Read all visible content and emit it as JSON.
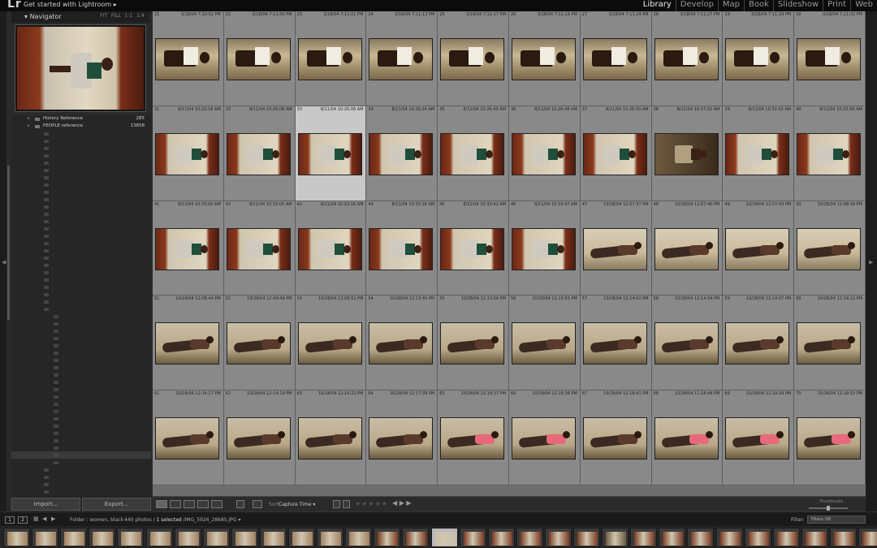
{
  "topbar": {
    "logo": "Lr",
    "get_started": "Get started with Lightroom  ▸",
    "modules": [
      {
        "label": "Library",
        "active": true
      },
      {
        "label": "Develop",
        "active": false
      },
      {
        "label": "Map",
        "active": false
      },
      {
        "label": "Book",
        "active": false
      },
      {
        "label": "Slideshow",
        "active": false
      },
      {
        "label": "Print",
        "active": false
      },
      {
        "label": "Web",
        "active": false
      }
    ]
  },
  "navigator": {
    "title": "Navigator",
    "options": "FIT FILL 1:1 1:4"
  },
  "folders": {
    "rows": [
      {
        "name": "History Reference",
        "count": "285",
        "level": 1,
        "style": "main"
      },
      {
        "name": "PEOPLE reference",
        "count": "13858",
        "level": 1,
        "style": "main"
      }
    ]
  },
  "left_bottom": {
    "import_label": "Import...",
    "export_label": "Export..."
  },
  "grid": {
    "rows": [
      [
        {
          "num": "21",
          "date": "3/18/04 7:10:52 PM"
        },
        {
          "num": "22",
          "date": "3/18/04 7:11:00 PM"
        },
        {
          "num": "23",
          "date": "3/18/04 7:11:01 PM"
        },
        {
          "num": "24",
          "date": "3/18/04 7:11:13 PM"
        },
        {
          "num": "25",
          "date": "3/18/04 7:11:17 PM"
        },
        {
          "num": "26",
          "date": "3/18/04 7:11:19 PM"
        },
        {
          "num": "27",
          "date": "3/18/04 7:11:24 PM"
        },
        {
          "num": "28",
          "date": "3/18/04 7:11:27 PM"
        },
        {
          "num": "29",
          "date": "3/18/04 7:11:29 PM"
        },
        {
          "num": "30",
          "date": "3/18/04 7:11:32 PM"
        }
      ],
      [
        {
          "num": "31",
          "date": "8/11/04 10:23:18 AM"
        },
        {
          "num": "32",
          "date": "8/11/04 10:26:08 AM"
        },
        {
          "num": "33",
          "date": "8/11/04 10:26:08 AM",
          "selected": true
        },
        {
          "num": "34",
          "date": "8/11/04 10:26:24 AM"
        },
        {
          "num": "35",
          "date": "8/11/04 10:26:40 AM"
        },
        {
          "num": "36",
          "date": "8/11/04 10:26:48 AM"
        },
        {
          "num": "37",
          "date": "8/11/04 10:26:50 AM"
        },
        {
          "num": "38",
          "date": "8/11/04 10:27:02 AM"
        },
        {
          "num": "39",
          "date": "8/11/04 10:32:52 AM"
        },
        {
          "num": "40",
          "date": "8/11/04 10:32:56 AM"
        }
      ],
      [
        {
          "num": "41",
          "date": "8/11/04 10:33:00 AM"
        },
        {
          "num": "42",
          "date": "8/11/04 10:33:05 AM"
        },
        {
          "num": "43",
          "date": "8/11/04 10:33:16 AM"
        },
        {
          "num": "44",
          "date": "8/11/04 10:33:18 AM"
        },
        {
          "num": "45",
          "date": "8/11/04 10:33:41 AM"
        },
        {
          "num": "46",
          "date": "8/11/04 10:33:47 AM"
        },
        {
          "num": "47",
          "date": "10/28/04 12:07:37 PM"
        },
        {
          "num": "48",
          "date": "10/28/04 12:07:40 PM"
        },
        {
          "num": "49",
          "date": "10/28/04 12:07:43 PM"
        },
        {
          "num": "50",
          "date": "10/28/04 12:08:39 PM"
        }
      ],
      [
        {
          "num": "51",
          "date": "10/28/04 12:08:44 PM"
        },
        {
          "num": "52",
          "date": "10/28/04 12:09:49 PM"
        },
        {
          "num": "53",
          "date": "10/28/04 12:09:52 PM"
        },
        {
          "num": "54",
          "date": "10/28/04 12:13:45 PM"
        },
        {
          "num": "55",
          "date": "10/28/04 12:13:54 PM"
        },
        {
          "num": "56",
          "date": "10/28/04 12:13:55 PM"
        },
        {
          "num": "57",
          "date": "10/28/04 12:14:02 PM"
        },
        {
          "num": "58",
          "date": "10/28/04 12:14:04 PM"
        },
        {
          "num": "59",
          "date": "10/28/04 12:14:07 PM"
        },
        {
          "num": "60",
          "date": "10/28/04 12:14:12 PM"
        }
      ],
      [
        {
          "num": "61",
          "date": "10/28/04 12:14:17 PM"
        },
        {
          "num": "62",
          "date": "10/28/04 12:14:19 PM"
        },
        {
          "num": "63",
          "date": "10/28/04 12:16:22 PM"
        },
        {
          "num": "64",
          "date": "10/28/04 12:17:39 PM"
        },
        {
          "num": "65",
          "date": "10/28/04 12:18:37 PM"
        },
        {
          "num": "66",
          "date": "10/28/04 12:18:38 PM"
        },
        {
          "num": "67",
          "date": "10/28/04 12:18:41 PM"
        },
        {
          "num": "68",
          "date": "10/28/04 12:18:44 PM"
        },
        {
          "num": "69",
          "date": "10/28/04 12:19:29 PM"
        },
        {
          "num": "70",
          "date": "10/28/04 12:19:32 PM"
        }
      ]
    ]
  },
  "toolbar": {
    "sort_label": "Sort:",
    "sort_value": "Capture Time ▾",
    "stars": "★★★★★",
    "nav_arrows": "◀ ▶   ▶",
    "thumbnails_label": "Thumbnails"
  },
  "film_header": {
    "screen1": "1",
    "screen2": "2",
    "folder_path": "Folder : women, black",
    "photo_count": "440 photos /",
    "selected_info": "1 selected",
    "file_name": "/IMG_5926_28685.JPG ▾",
    "filter_label": "Filter:",
    "filter_value": "Filters Off"
  },
  "colors": {
    "accent": "#eeeeee",
    "grid_bg": "#6e6e6e",
    "cell_bg": "#898989",
    "selected_cell": "#c8c8c8",
    "panel_bg": "#2a2a2a"
  }
}
